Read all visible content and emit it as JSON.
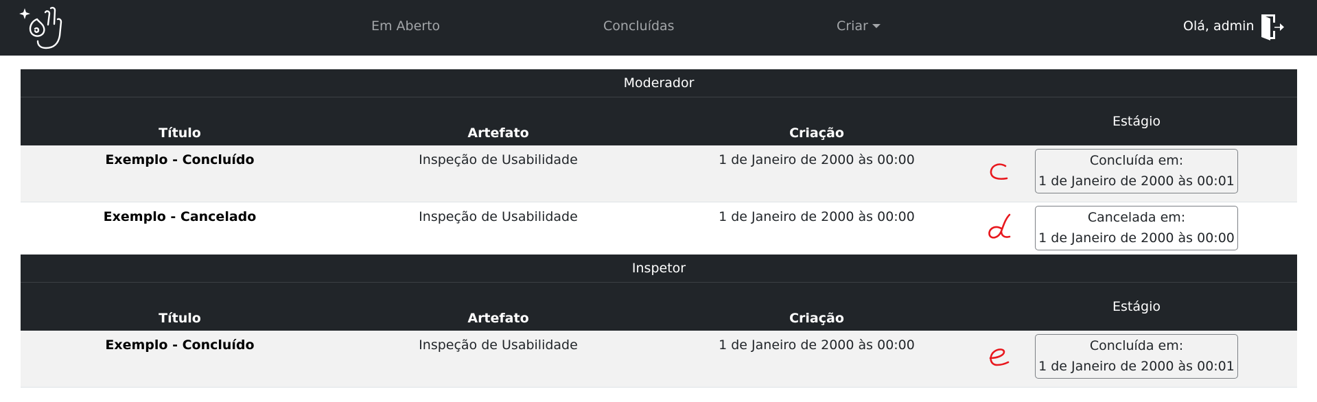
{
  "nav": {
    "items": [
      {
        "label": "Em Aberto"
      },
      {
        "label": "Concluídas"
      },
      {
        "label": "Criar"
      }
    ],
    "greeting": "Olá, admin",
    "icons": {
      "logo": "ok-hand-sparkle-icon",
      "logout": "door-exit-icon"
    }
  },
  "columns": {
    "title": "Título",
    "artifact": "Artefato",
    "created": "Criação",
    "stage": "Estágio"
  },
  "sections": [
    {
      "name": "Moderador",
      "rows": [
        {
          "title": "Exemplo - Concluído",
          "artifact": "Inspeção de Usabilidade",
          "created": "1 de Janeiro de 2000 às 00:00",
          "stage_label": "Concluída em:",
          "stage_date": "1 de Janeiro de 2000 às 00:01",
          "annotation": "c"
        },
        {
          "title": "Exemplo - Cancelado",
          "artifact": "Inspeção de Usabilidade",
          "created": "1 de Janeiro de 2000 às 00:00",
          "stage_label": "Cancelada em:",
          "stage_date": "1 de Janeiro de 2000 às 00:00",
          "annotation": "d"
        }
      ]
    },
    {
      "name": "Inspetor",
      "rows": [
        {
          "title": "Exemplo - Concluído",
          "artifact": "Inspeção de Usabilidade",
          "created": "1 de Janeiro de 2000 às 00:00",
          "stage_label": "Concluída em:",
          "stage_date": "1 de Janeiro de 2000 às 00:01",
          "annotation": "e"
        }
      ]
    }
  ],
  "colors": {
    "navbar": "#212529",
    "annotation": "#e8171d",
    "row_shade": "#f2f2f2"
  }
}
